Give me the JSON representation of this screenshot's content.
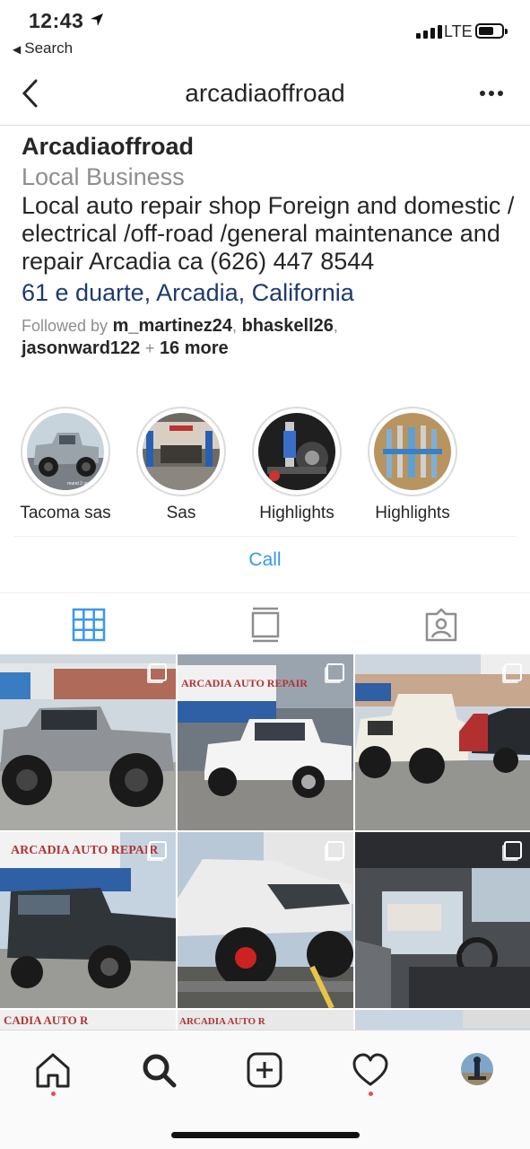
{
  "status_bar": {
    "time": "12:43",
    "back_label": "Search",
    "network": "LTE"
  },
  "nav": {
    "title": "arcadiaoffroad"
  },
  "profile": {
    "name": "Arcadiaoffroad",
    "category": "Local Business",
    "bio": "Local auto repair shop Foreign and domestic / electrical /off-road /general maintenance and repair Arcadia ca (626) 447 8544",
    "address": "61 e duarte, Arcadia, California",
    "followed_by_label": "Followed by",
    "followers": [
      "m_martinez24",
      "bhaskell26",
      "jasonward122"
    ],
    "more": "16 more"
  },
  "highlights": [
    {
      "label": "Tacoma sas",
      "icon": "truck-photo"
    },
    {
      "label": "Sas",
      "icon": "shop-photo"
    },
    {
      "label": "Highlights",
      "icon": "suspension-photo"
    },
    {
      "label": "Highlights",
      "icon": "shocks-photo"
    }
  ],
  "call_button": "Call",
  "tabs": [
    "grid-icon",
    "feed-icon",
    "tagged-icon"
  ],
  "grid_posts": [
    {
      "subject": "gray silverado truck",
      "multi": true
    },
    {
      "subject": "white silverado at shop",
      "multi": true,
      "sign_text": "ARCADIA AUTO REPAIR"
    },
    {
      "subject": "white jeep wrangler",
      "multi": true
    },
    {
      "subject": "dark land cruiser",
      "multi": true,
      "sign_text": "ARCADIA AUTO REPAIR"
    },
    {
      "subject": "lifted tacoma on trailer",
      "multi": true
    },
    {
      "subject": "truck interior",
      "multi": true
    }
  ],
  "bottom_nav": [
    "home-icon",
    "search-icon",
    "add-post-icon",
    "activity-heart-icon",
    "profile-avatar"
  ],
  "colors": {
    "link_blue": "#3897f0",
    "address_blue": "#1e3a6e",
    "muted_gray": "#8e8e8e",
    "notification_red": "#ed4956"
  }
}
